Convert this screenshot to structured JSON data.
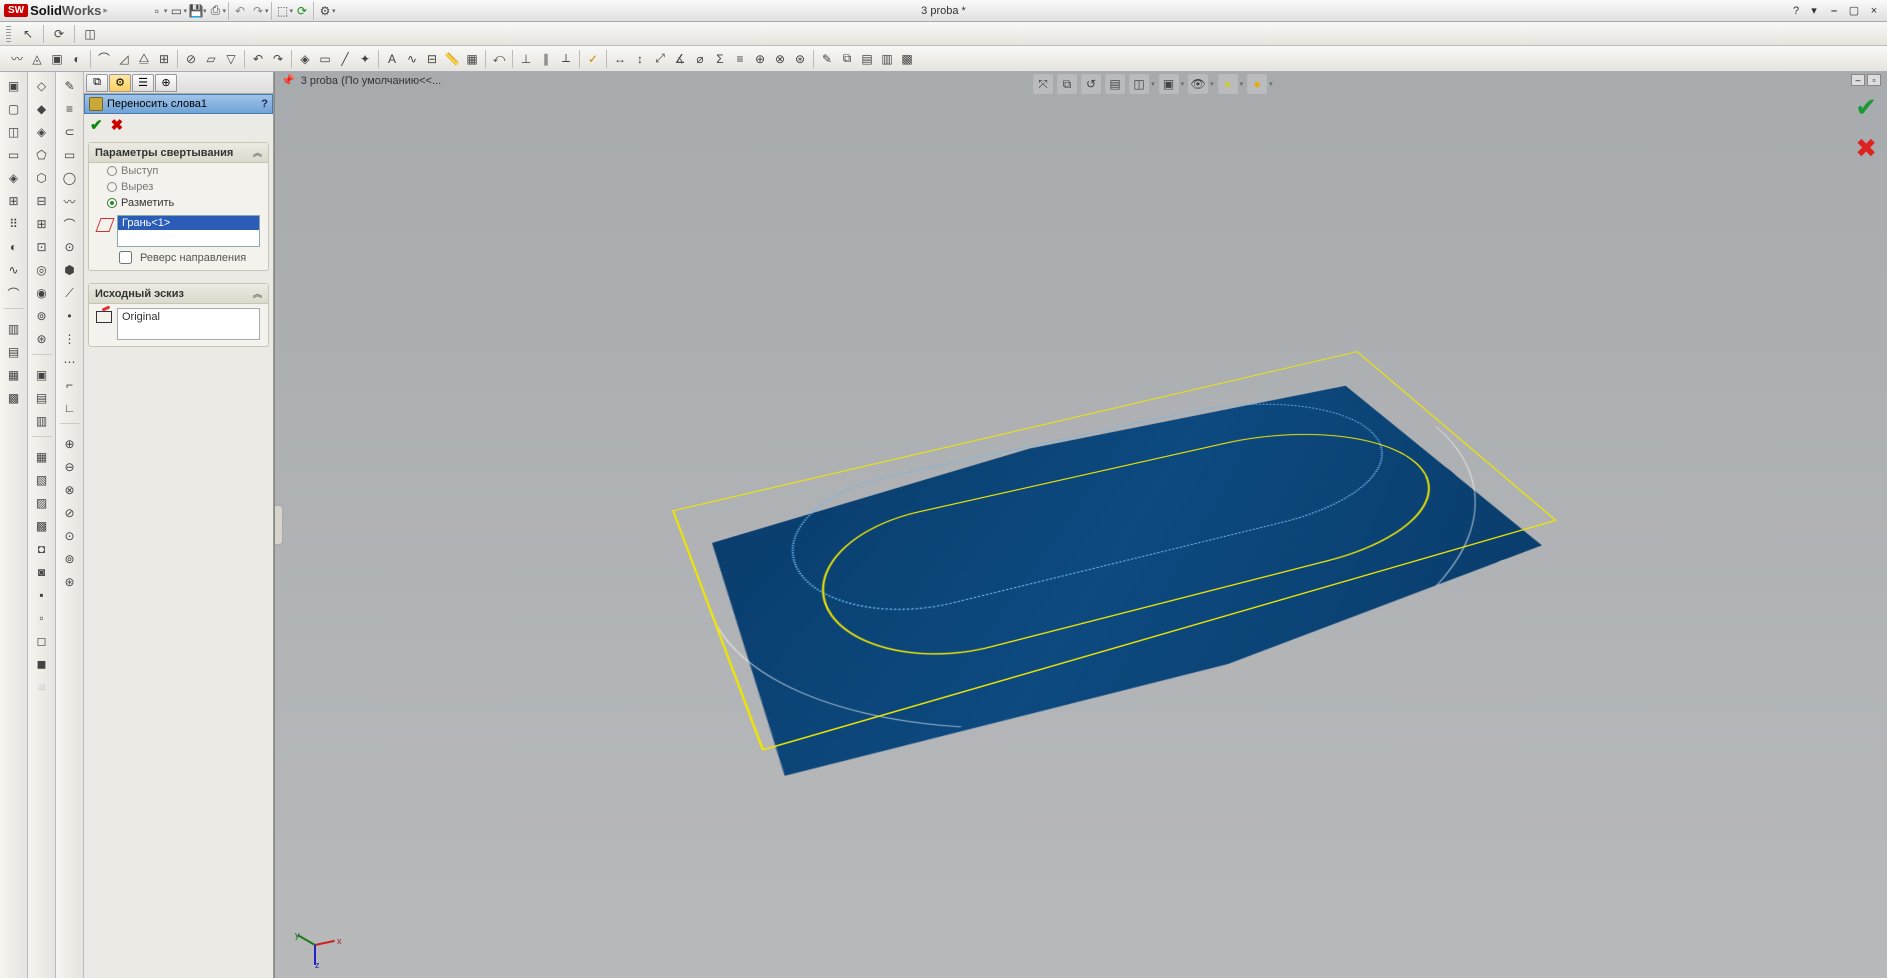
{
  "app": {
    "brand1": "Solid",
    "brand2": "Works",
    "doc_title": "3 proba *"
  },
  "viewport": {
    "tab_label": "3 proba  (По умолчанию<<..."
  },
  "feature": {
    "title": "Переносить слова1",
    "help": "?",
    "group1_title": "Параметры свертывания",
    "radio_extrude": "Выступ",
    "radio_cut": "Вырез",
    "radio_scribe": "Разметить",
    "face_selection": "Грань<1>",
    "reverse_label": "Реверс направления",
    "group2_title": "Исходный эскиз",
    "sketch_value": "Original"
  }
}
